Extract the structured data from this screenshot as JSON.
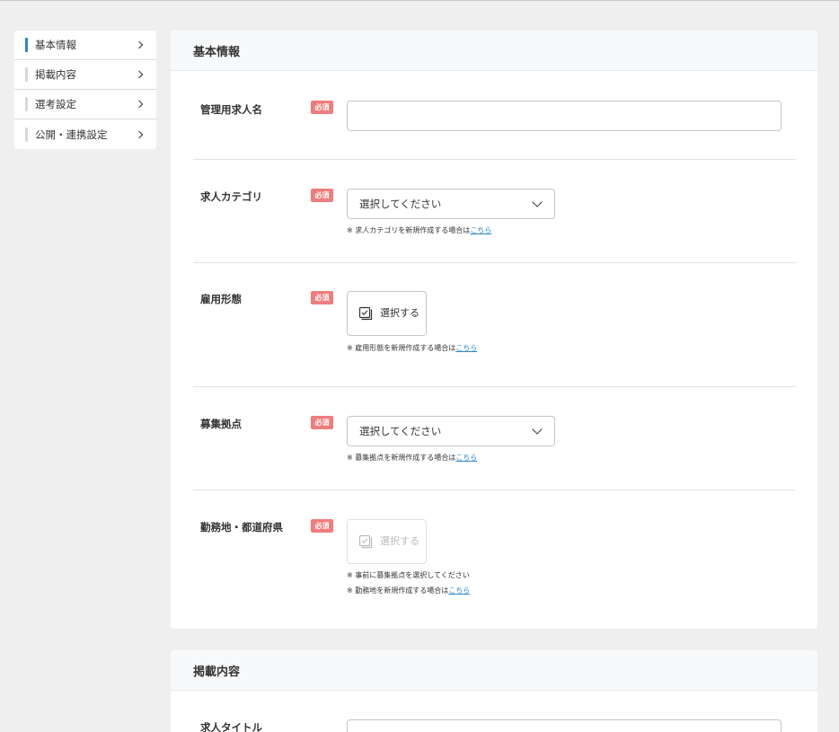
{
  "sidebar": {
    "items": [
      {
        "label": "基本情報"
      },
      {
        "label": "掲載内容"
      },
      {
        "label": "選考設定"
      },
      {
        "label": "公開・連携設定"
      }
    ]
  },
  "basic": {
    "title": "基本情報",
    "required_label": "必須",
    "admin_name": {
      "label": "管理用求人名",
      "value": ""
    },
    "category": {
      "label": "求人カテゴリ",
      "selected": "選択してください",
      "note_prefix": "※ 求人カテゴリを新規作成する場合は",
      "note_link": "こちら"
    },
    "employment": {
      "label": "雇用形態",
      "button": "選択する",
      "note_prefix": "※ 雇用形態を新規作成する場合は",
      "note_link": "こちら"
    },
    "base": {
      "label": "募集拠点",
      "selected": "選択してください",
      "note_prefix": "※ 募集拠点を新規作成する場合は",
      "note_link": "こちら"
    },
    "location": {
      "label": "勤務地・都道府県",
      "button": "選択する",
      "note1": "※ 事前に募集拠点を選択してください",
      "note2_prefix": "※ 勤務地を新規作成する場合は",
      "note2_link": "こちら"
    }
  },
  "content": {
    "title": "掲載内容",
    "job_title": {
      "label": "求人タイトル",
      "value": ""
    }
  },
  "colors": {
    "accent": "#2f87c8",
    "required": "#f07c7c"
  }
}
